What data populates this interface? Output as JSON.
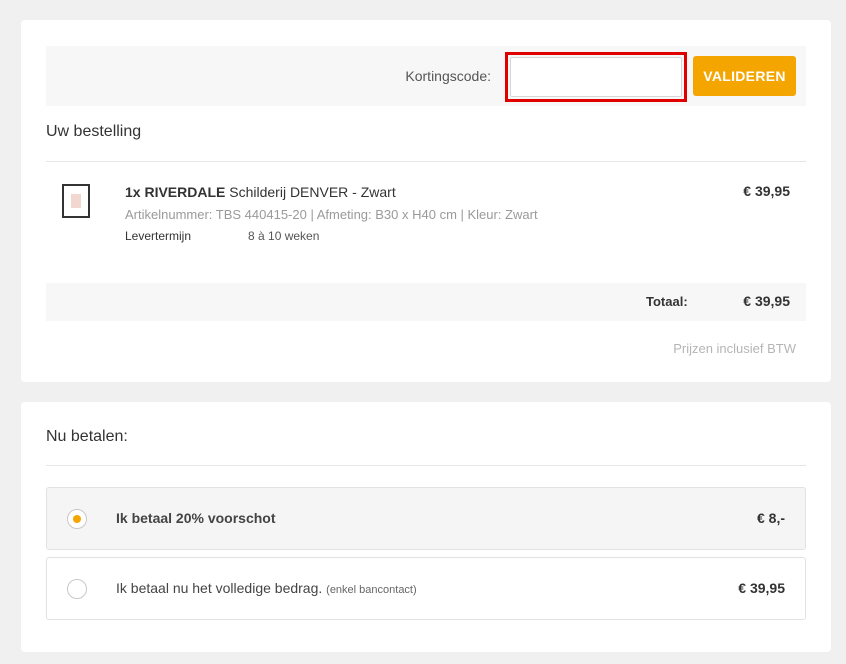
{
  "coupon": {
    "label": "Kortingscode:",
    "value": "",
    "placeholder": "",
    "button_label": "VALIDEREN"
  },
  "order": {
    "title": "Uw bestelling",
    "items": [
      {
        "qty_name": "1x RIVERDALE",
        "description": " Schilderij DENVER - Zwart",
        "meta": "Artikelnummer: TBS 440415-20   | Afmeting: B30 x H40 cm | Kleur: Zwart",
        "lead_label": "Levertermijn",
        "lead_value": "8 à 10 weken",
        "price": "€ 39,95"
      }
    ],
    "total_label": "Totaal:",
    "total_value": "€ 39,95",
    "vat_note": "Prijzen inclusief BTW"
  },
  "payment": {
    "title": "Nu betalen:",
    "options": [
      {
        "label": "Ik betaal 20% voorschot",
        "note": "",
        "amount": "€ 8,-",
        "selected": true
      },
      {
        "label": "Ik betaal nu het volledige bedrag. ",
        "note": "(enkel bancontact)",
        "amount": "€ 39,95",
        "selected": false
      }
    ]
  },
  "colors": {
    "accent": "#f5a500",
    "highlight_border": "#e00000"
  }
}
